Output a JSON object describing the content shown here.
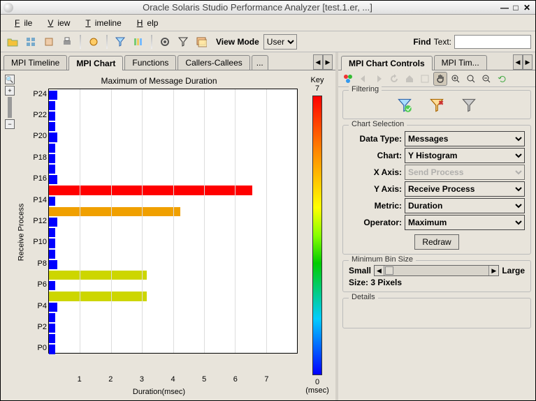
{
  "window": {
    "title": "Oracle Solaris Studio Performance Analyzer [test.1.er, ...]"
  },
  "menu": {
    "file": "File",
    "view": "View",
    "timeline": "Timeline",
    "help": "Help"
  },
  "toolbar": {
    "view_mode_label": "View Mode",
    "view_mode_value": "User",
    "find_label": "Find",
    "find_field_label": "Text:",
    "find_value": ""
  },
  "left_tabs": {
    "items": [
      "MPI Timeline",
      "MPI Chart",
      "Functions",
      "Callers-Callees"
    ],
    "active_index": 1,
    "overflow": "..."
  },
  "right_tabs": {
    "items": [
      "MPI Chart Controls",
      "MPI Tim..."
    ],
    "active_index": 0
  },
  "chart_data": {
    "type": "bar",
    "title": "Maximum of Message Duration",
    "xlabel": "Duration(msec)",
    "ylabel": "Receive Process",
    "xlim": [
      0,
      8
    ],
    "xticks": [
      1,
      2,
      3,
      4,
      5,
      6,
      7
    ],
    "yticks": [
      "P0",
      "P2",
      "P4",
      "P6",
      "P8",
      "P10",
      "P12",
      "P14",
      "P16",
      "P18",
      "P20",
      "P22",
      "P24"
    ],
    "series": [
      {
        "proc": "P0",
        "value": 0.22,
        "color": "#0000ff"
      },
      {
        "proc": "P1",
        "value": 0.22,
        "color": "#0000ff"
      },
      {
        "proc": "P2",
        "value": 0.22,
        "color": "#0000ff"
      },
      {
        "proc": "P3",
        "value": 0.22,
        "color": "#0000ff"
      },
      {
        "proc": "P4",
        "value": 0.3,
        "color": "#0000ff"
      },
      {
        "proc": "P5",
        "value": 3.4,
        "color": "#cdd600"
      },
      {
        "proc": "P6",
        "value": 0.22,
        "color": "#0000ff"
      },
      {
        "proc": "P7",
        "value": 3.4,
        "color": "#cdd600"
      },
      {
        "proc": "P8",
        "value": 0.3,
        "color": "#0000ff"
      },
      {
        "proc": "P9",
        "value": 0.22,
        "color": "#0000ff"
      },
      {
        "proc": "P10",
        "value": 0.22,
        "color": "#0000ff"
      },
      {
        "proc": "P11",
        "value": 0.22,
        "color": "#0000ff"
      },
      {
        "proc": "P12",
        "value": 0.3,
        "color": "#0000ff"
      },
      {
        "proc": "P13",
        "value": 4.55,
        "color": "#f0a000"
      },
      {
        "proc": "P14",
        "value": 0.22,
        "color": "#0000ff"
      },
      {
        "proc": "P15",
        "value": 7.05,
        "color": "#ff0000"
      },
      {
        "proc": "P16",
        "value": 0.3,
        "color": "#0000ff"
      },
      {
        "proc": "P17",
        "value": 0.22,
        "color": "#0000ff"
      },
      {
        "proc": "P18",
        "value": 0.22,
        "color": "#0000ff"
      },
      {
        "proc": "P19",
        "value": 0.22,
        "color": "#0000ff"
      },
      {
        "proc": "P20",
        "value": 0.3,
        "color": "#0000ff"
      },
      {
        "proc": "P21",
        "value": 0.22,
        "color": "#0000ff"
      },
      {
        "proc": "P22",
        "value": 0.22,
        "color": "#0000ff"
      },
      {
        "proc": "P23",
        "value": 0.22,
        "color": "#0000ff"
      },
      {
        "proc": "P24",
        "value": 0.3,
        "color": "#0000ff"
      }
    ],
    "colorscale": {
      "title": "Key",
      "min": 0,
      "max": 7,
      "unit": "(msec)"
    }
  },
  "controls": {
    "filtering_label": "Filtering",
    "chart_selection_label": "Chart Selection",
    "fields": {
      "data_type": {
        "label": "Data Type:",
        "value": "Messages"
      },
      "chart": {
        "label": "Chart:",
        "value": "Y Histogram"
      },
      "x_axis": {
        "label": "X Axis:",
        "value": "Send Process",
        "disabled": true
      },
      "y_axis": {
        "label": "Y Axis:",
        "value": "Receive Process"
      },
      "metric": {
        "label": "Metric:",
        "value": "Duration"
      },
      "operator": {
        "label": "Operator:",
        "value": "Maximum"
      }
    },
    "redraw_label": "Redraw",
    "min_bin": {
      "label": "Minimum Bin Size",
      "small": "Small",
      "large": "Large",
      "size_text": "Size: 3 Pixels"
    },
    "details_label": "Details"
  }
}
